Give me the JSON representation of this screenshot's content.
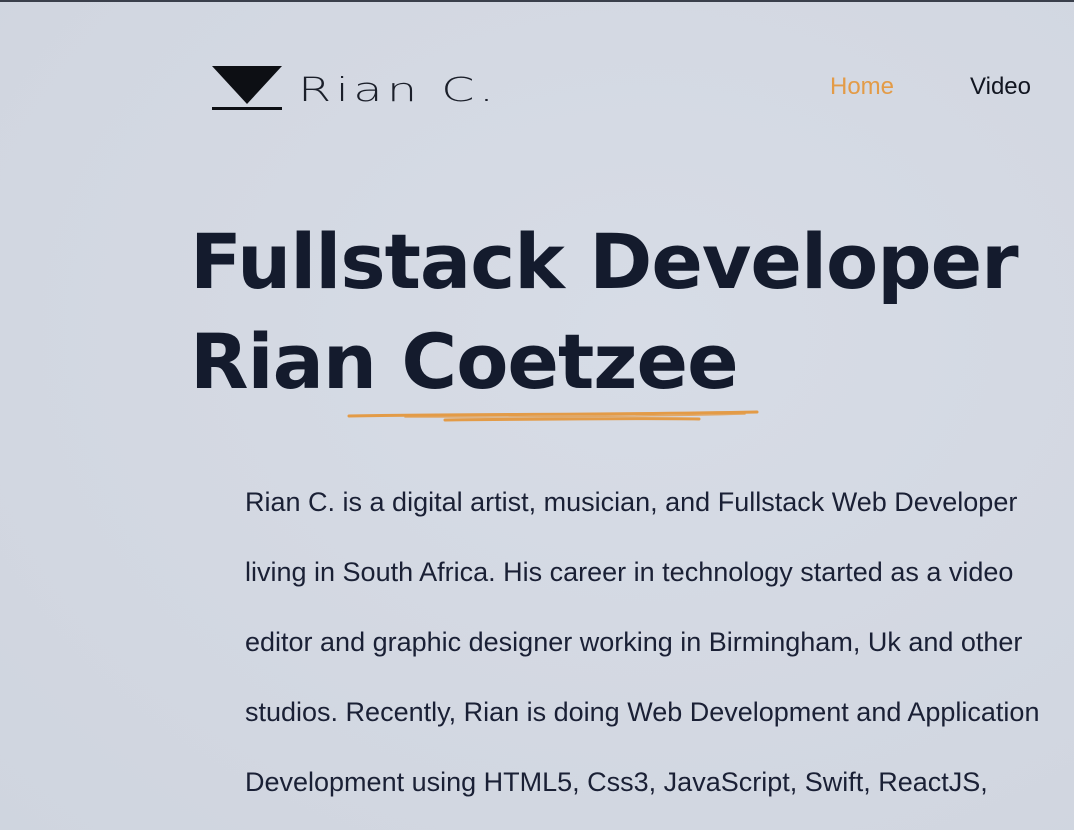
{
  "header": {
    "logo_text": "Rian C.",
    "logo_icon": "inverted-triangle-logo-icon",
    "nav": [
      {
        "label": "Home",
        "active": true
      },
      {
        "label": "Video",
        "active": false
      }
    ]
  },
  "hero": {
    "line1": "Fullstack Developer",
    "line2": "Rian Coetzee"
  },
  "bio": {
    "lines": [
      "Rian C. is a digital artist, musician, and Fullstack Web Developer",
      "living in South Africa. His career in technology started as a video",
      "editor and graphic designer working in Birmingham, Uk and other",
      "studios. Recently, Rian is doing Web Development and Application",
      "Development using HTML5, Css3, JavaScript, Swift, ReactJS,"
    ]
  },
  "colors": {
    "background": "#d4d9e3",
    "text": "#141b2d",
    "accent": "#e39b47"
  }
}
